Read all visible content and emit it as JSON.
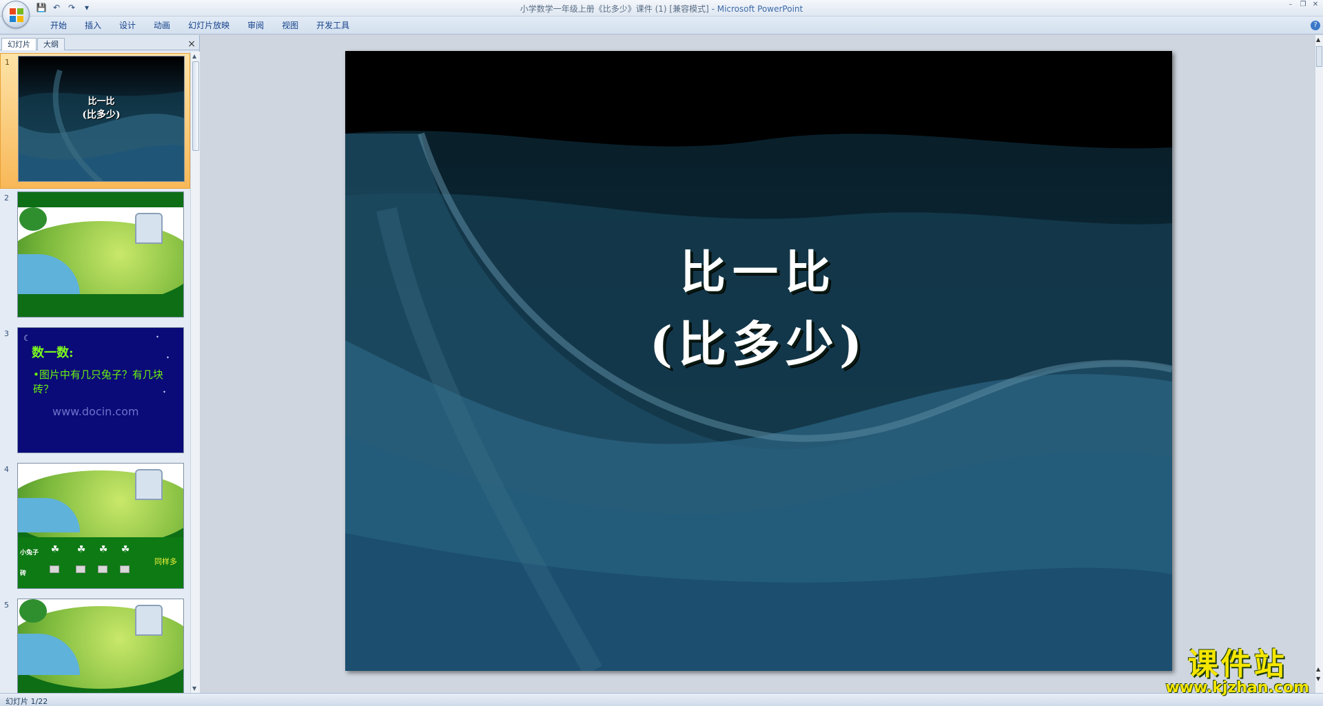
{
  "window": {
    "title": "小学数学一年级上册《比多少》课件 (1) [兼容模式]",
    "app_suffix": " - Microsoft PowerPoint"
  },
  "ribbon": {
    "tabs": [
      "开始",
      "插入",
      "设计",
      "动画",
      "幻灯片放映",
      "审阅",
      "视图",
      "开发工具"
    ]
  },
  "left_pane": {
    "tab_slides": "幻灯片",
    "tab_outline": "大纲",
    "close": "×"
  },
  "thumbnails": [
    {
      "num": "1",
      "line1": "比一比",
      "line2": "(比多少)"
    },
    {
      "num": "2"
    },
    {
      "num": "3",
      "heading": "数一数:",
      "body": "•图片中有几只兔子？有几块砖？",
      "watermark": "www.docin.com"
    },
    {
      "num": "4",
      "label_rabbit": "小兔子",
      "label_brick": "砖",
      "same": "同样多"
    },
    {
      "num": "5"
    }
  ],
  "slide": {
    "line1": "比一比",
    "line2": "(比多少)"
  },
  "watermark": {
    "big": "课件站",
    "url": "www.kjzhan.com"
  },
  "status": {
    "slide_info": "幻灯片 1/22"
  },
  "colors": {
    "slide_text": "#ffffff",
    "thumb3_bg": "#0a0a78",
    "thumb3_text": "#6df20f",
    "watermark_text": "#f5e600",
    "selected_thumb": "#f8b858"
  }
}
